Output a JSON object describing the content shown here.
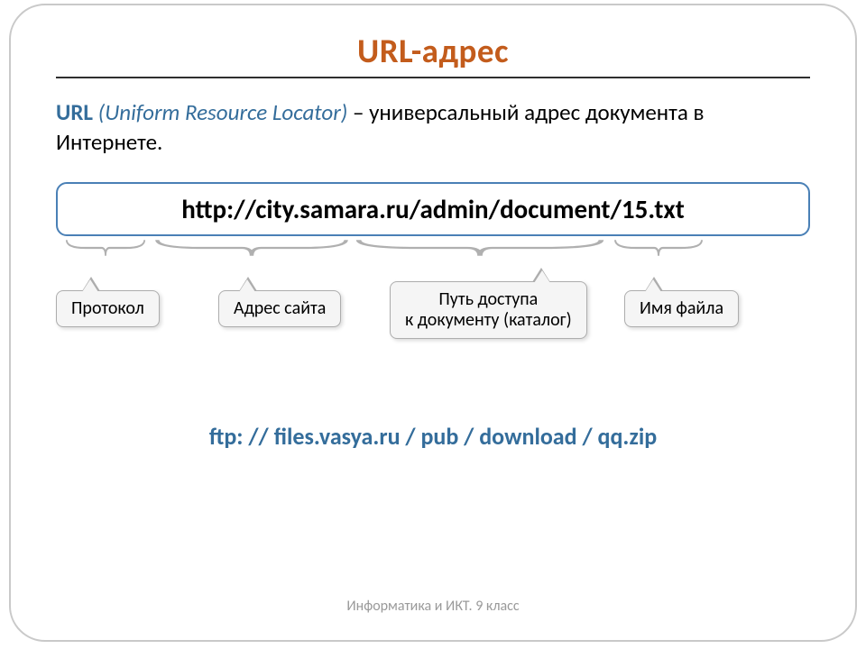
{
  "title": "URL-адрес",
  "definition": {
    "term": "URL",
    "paren": "(Uniform Resource Locator)",
    "rest": " – универсальный адрес документа в Интернете."
  },
  "url_example": "http://city.samara.ru/admin/document/15.txt",
  "callouts": {
    "protocol": "Протокол",
    "site": "Адрес сайта",
    "path_line1": "Путь доступа",
    "path_line2": "к документу (каталог)",
    "filename": "Имя файла"
  },
  "example2": "ftp: // files.vasya.ru / pub / download / qq.zip",
  "footer": "Информатика и ИКТ. 9 класс"
}
